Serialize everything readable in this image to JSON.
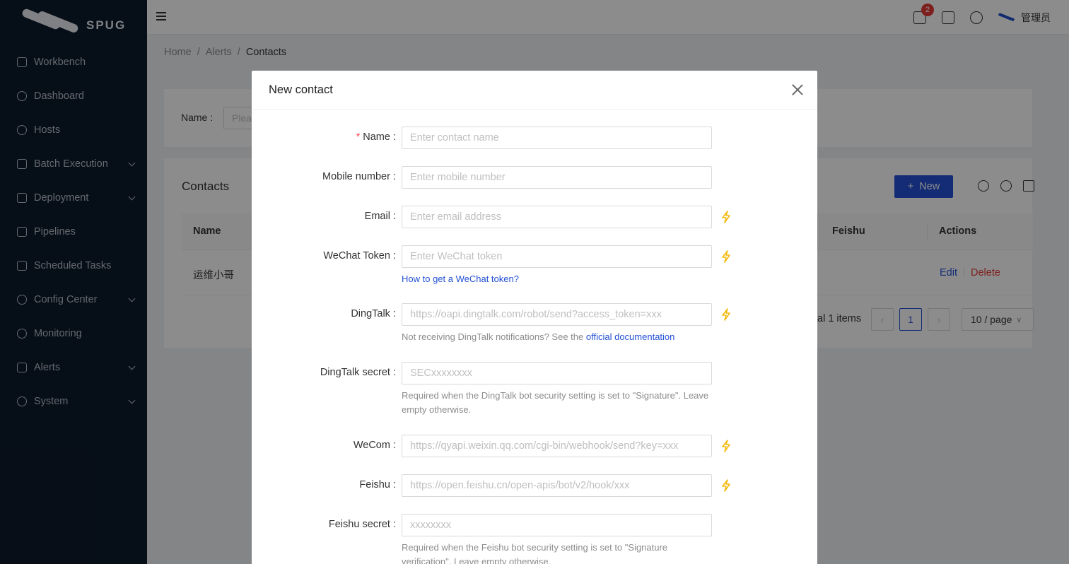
{
  "app": {
    "logo_text": "SPUG"
  },
  "sidebar": {
    "items": [
      {
        "label": "Workbench",
        "icon": "monitor-icon",
        "has_submenu": false
      },
      {
        "label": "Dashboard",
        "icon": "dashboard-icon",
        "has_submenu": false
      },
      {
        "label": "Hosts",
        "icon": "cloud-server-icon",
        "has_submenu": false
      },
      {
        "label": "Batch Execution",
        "icon": "terminal-icon",
        "has_submenu": true
      },
      {
        "label": "Deployment",
        "icon": "flag-icon",
        "has_submenu": true
      },
      {
        "label": "Pipelines",
        "icon": "pipeline-icon",
        "has_submenu": false
      },
      {
        "label": "Scheduled Tasks",
        "icon": "schedule-icon",
        "has_submenu": false
      },
      {
        "label": "Config Center",
        "icon": "cluster-icon",
        "has_submenu": true
      },
      {
        "label": "Monitoring",
        "icon": "search-monitor-icon",
        "has_submenu": false
      },
      {
        "label": "Alerts",
        "icon": "alert-flag-icon",
        "has_submenu": true
      },
      {
        "label": "System",
        "icon": "gear-icon",
        "has_submenu": true
      }
    ]
  },
  "header": {
    "notification_count": "2",
    "user_name": "管理员"
  },
  "breadcrumb": [
    "Home",
    "Alerts",
    "Contacts"
  ],
  "filter": {
    "label": "Name",
    "placeholder": "Plea"
  },
  "table": {
    "title": "Contacts",
    "new_button": "New",
    "columns": [
      "Name",
      "Feishu",
      "Actions"
    ],
    "rows": [
      {
        "name": "运维小哥",
        "edit": "Edit",
        "delete": "Delete"
      }
    ],
    "total_text": "tal 1 items",
    "current_page": "1",
    "page_size": "10 / page"
  },
  "modal": {
    "title": "New contact",
    "fields": {
      "name": {
        "label": "Name",
        "placeholder": "Enter contact name",
        "required": true
      },
      "mobile": {
        "label": "Mobile number",
        "placeholder": "Enter mobile number"
      },
      "email": {
        "label": "Email",
        "placeholder": "Enter email address"
      },
      "wechat": {
        "label": "WeChat Token",
        "placeholder": "Enter WeChat token",
        "help_link": "How to get a WeChat token?"
      },
      "dingtalk": {
        "label": "DingTalk",
        "placeholder": "https://oapi.dingtalk.com/robot/send?access_token=xxx",
        "help_prefix": "Not receiving DingTalk notifications? See the ",
        "help_link": "official documentation"
      },
      "dingtalk_secret": {
        "label": "DingTalk secret",
        "placeholder": "SECxxxxxxxx",
        "help": "Required when the DingTalk bot security setting is set to \"Signature\". Leave empty otherwise."
      },
      "wecom": {
        "label": "WeCom",
        "placeholder": "https://qyapi.weixin.qq.com/cgi-bin/webhook/send?key=xxx"
      },
      "feishu": {
        "label": "Feishu",
        "placeholder": "https://open.feishu.cn/open-apis/bot/v2/hook/xxx"
      },
      "feishu_secret": {
        "label": "Feishu secret",
        "placeholder": "xxxxxxxx",
        "help": "Required when the Feishu bot security setting is set to \"Signature verification\". Leave empty otherwise."
      }
    }
  },
  "colors": {
    "primary": "#2451d6",
    "danger": "#e53935",
    "sidebar_bg": "#0c1a2c",
    "bolt": "#f5b90f"
  }
}
